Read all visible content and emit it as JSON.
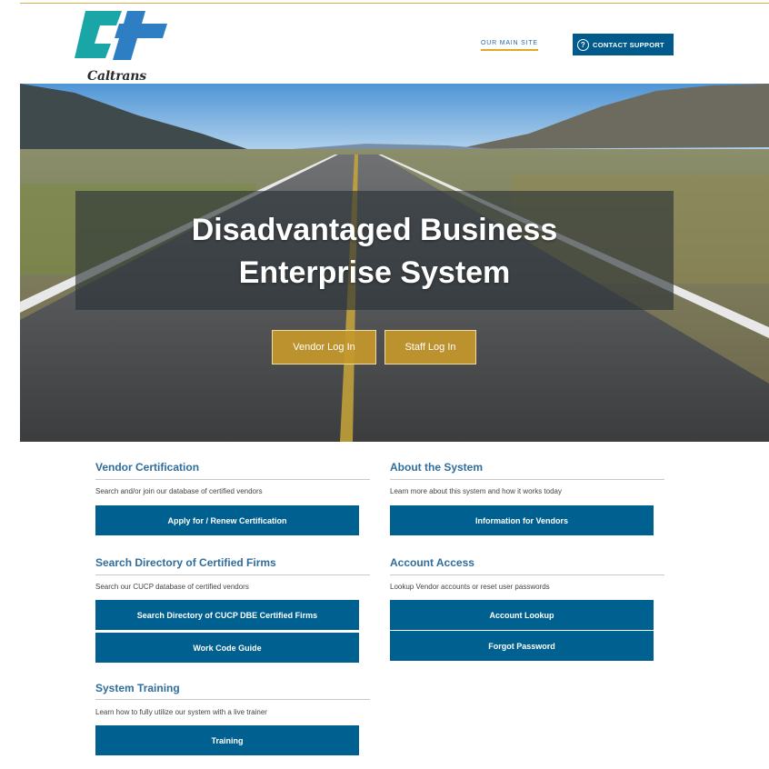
{
  "header": {
    "logo_text": "Caltrans",
    "main_site_link": "OUR MAIN SITE",
    "contact_button": {
      "label": "CONTACT SUPPORT",
      "icon": "question-circle-icon"
    }
  },
  "hero": {
    "title_line1": "Disadvantaged Business",
    "title_line2": "Enterprise System",
    "buttons": {
      "vendor_login": "Vendor Log In",
      "staff_login": "Staff Log In"
    }
  },
  "sections": {
    "vendor_certification": {
      "title": "Vendor Certification",
      "description": "Search and/or join our database of certified vendors",
      "buttons": [
        "Apply for / Renew Certification"
      ]
    },
    "search_directory": {
      "title": "Search Directory of Certified Firms",
      "description": "Search our CUCP database of certified vendors",
      "buttons": [
        "Search Directory of CUCP DBE Certified Firms",
        "Work Code Guide"
      ]
    },
    "system_training": {
      "title": "System Training",
      "description": "Learn how to fully utilize our system with a live trainer",
      "buttons": [
        "Training"
      ]
    },
    "about_system": {
      "title": "About the System",
      "description": "Learn more about this system and how it works today",
      "buttons": [
        "Information for Vendors"
      ]
    },
    "account_access": {
      "title": "Account Access",
      "description": "Lookup Vendor accounts or reset user passwords",
      "buttons": [
        "Account Lookup",
        "Forgot Password"
      ]
    }
  },
  "colors": {
    "primary_blue": "#00608f",
    "heading_blue": "#2f6d9c",
    "gold": "#c6982c",
    "logo_teal": "#1aa6a6",
    "logo_blue": "#2e7ec4"
  }
}
